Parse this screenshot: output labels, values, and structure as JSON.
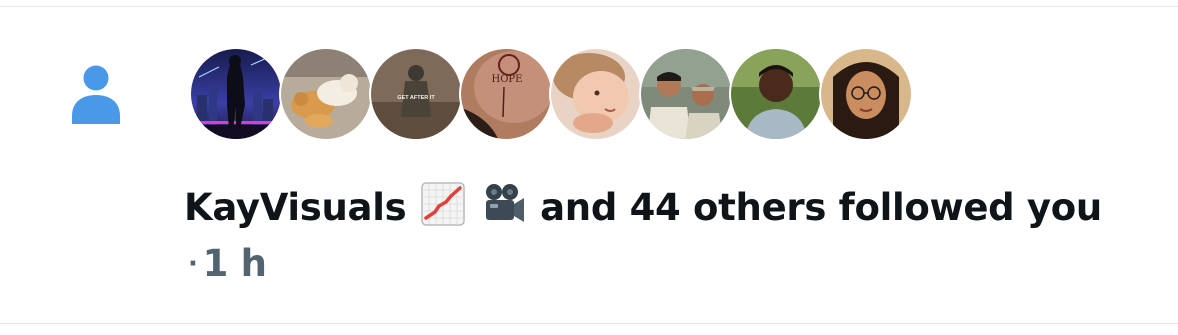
{
  "notification": {
    "type_icon": "person-icon",
    "accent_color": "#4a99e9",
    "avatars": [
      {
        "label": "KayVisuals avatar",
        "caption": ""
      },
      {
        "label": "cats avatar",
        "caption": ""
      },
      {
        "label": "soldier avatar",
        "caption": "GET AFTER IT"
      },
      {
        "label": "tattoo avatar",
        "caption": "HOPE"
      },
      {
        "label": "child avatar",
        "caption": ""
      },
      {
        "label": "two men avatar",
        "caption": ""
      },
      {
        "label": "woman outdoors avatar",
        "caption": ""
      },
      {
        "label": "illustrated woman avatar",
        "caption": ""
      }
    ],
    "actor_name": "KayVisuals",
    "actor_emoji": [
      "chart-increasing-emoji",
      "movie-camera-emoji"
    ],
    "action_text": "and 44 others followed you",
    "separator": "·",
    "timestamp": "1 h"
  }
}
